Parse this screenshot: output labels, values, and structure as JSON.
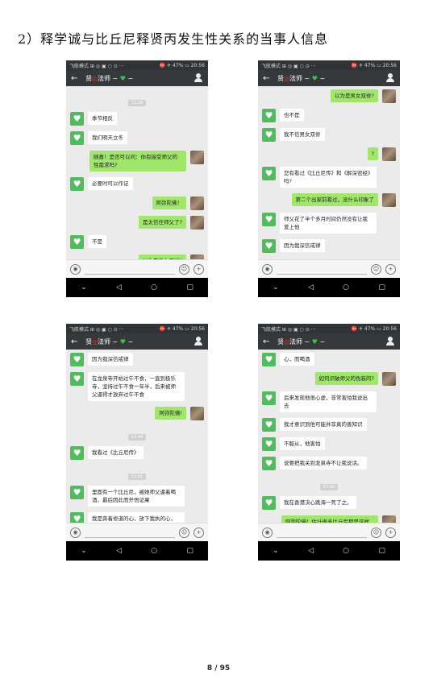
{
  "heading": "2）释学诚与比丘尼释贤丙发生性关系的当事人信息",
  "status": {
    "left": "飞航模式 ⊞ ◎ ▣ ○ ⊙ ···",
    "right": "⛔ ✈ 47% ▭ 20:56"
  },
  "title": {
    "prefix": "贤",
    "redchar": "◎",
    "middle": "法师 ~ ",
    "heart": "♥",
    "suffix": " ~"
  },
  "nav": {
    "down": "⌄",
    "back": "◁",
    "home": "○",
    "recent": "▢"
  },
  "input": {
    "voice": "◉",
    "emoji": "☺",
    "plus": "+"
  },
  "screens": [
    {
      "messages": [
        {
          "side": "ts",
          "text": "11:18"
        },
        {
          "side": "left",
          "text": "季节相反"
        },
        {
          "side": "left",
          "text": "我们明天立冬"
        },
        {
          "side": "right",
          "text": "随喜！是否可以问：你有接受师父的性需求吗?"
        },
        {
          "side": "left",
          "text": "必要时可以作证"
        },
        {
          "side": "right",
          "text": "阿弥陀佛！"
        },
        {
          "side": "right",
          "text": "是太信任师父了?"
        },
        {
          "side": "left",
          "text": "不是"
        },
        {
          "side": "right",
          "text": "以为是男女双修?"
        }
      ]
    },
    {
      "messages": [
        {
          "side": "right",
          "text": "以为是男女双修?"
        },
        {
          "side": "left",
          "text": "也不是"
        },
        {
          "side": "left",
          "text": "我不信男女双修"
        },
        {
          "side": "right",
          "text": "?"
        },
        {
          "side": "left",
          "text": "您有看过《比丘尼传》和《解深密经》吗?"
        },
        {
          "side": "right",
          "text": "第二个出家前看过，没什么印象了"
        },
        {
          "side": "left",
          "text": "师父花了半个多月时间仍然没有让我爱上他"
        },
        {
          "side": "left",
          "text": "因为我深信戒律"
        }
      ]
    },
    {
      "messages": [
        {
          "side": "left",
          "text": "因为我深信戒律"
        },
        {
          "side": "left",
          "text": "在龙泉寺开始过午不食，一直到极乐寺，坚持过午不食一年半，后来被师父逼得才放弃过午不食"
        },
        {
          "side": "right",
          "text": "阿弥陀佛!"
        },
        {
          "side": "ts",
          "text": "12:44"
        },
        {
          "side": "left",
          "text": "我看过《比丘尼传》"
        },
        {
          "side": "ts",
          "text": "12:51"
        },
        {
          "side": "left",
          "text": "里面有一个比丘尼，被她师父逼着喝酒，最后因此而开悟证果"
        },
        {
          "side": "left",
          "text": "我是奔着修道的心，放下我执的心，而喝酒"
        }
      ]
    },
    {
      "messages": [
        {
          "side": "left",
          "text": "心，而喝酒"
        },
        {
          "side": "right",
          "text": "如何识破师父的伪装的?"
        },
        {
          "side": "left",
          "text": "后来发现他很心虚，非常害怕我说出去"
        },
        {
          "side": "left",
          "text": "我才意识到他可能并非真的善知识"
        },
        {
          "side": "left",
          "text": "不服从，他害怕"
        },
        {
          "side": "left",
          "text": "说要把我关到龙泉寺不让我说话。"
        },
        {
          "side": "ts",
          "text": "17:09"
        },
        {
          "side": "left",
          "text": "我在香港决心跳海一死了之。"
        },
        {
          "side": "right",
          "text": "阿弥陀佛！估计很多比丘尼都是这样想的，贤◉法师说：学◉法师就"
        }
      ]
    }
  ],
  "footer": "8 / 95"
}
